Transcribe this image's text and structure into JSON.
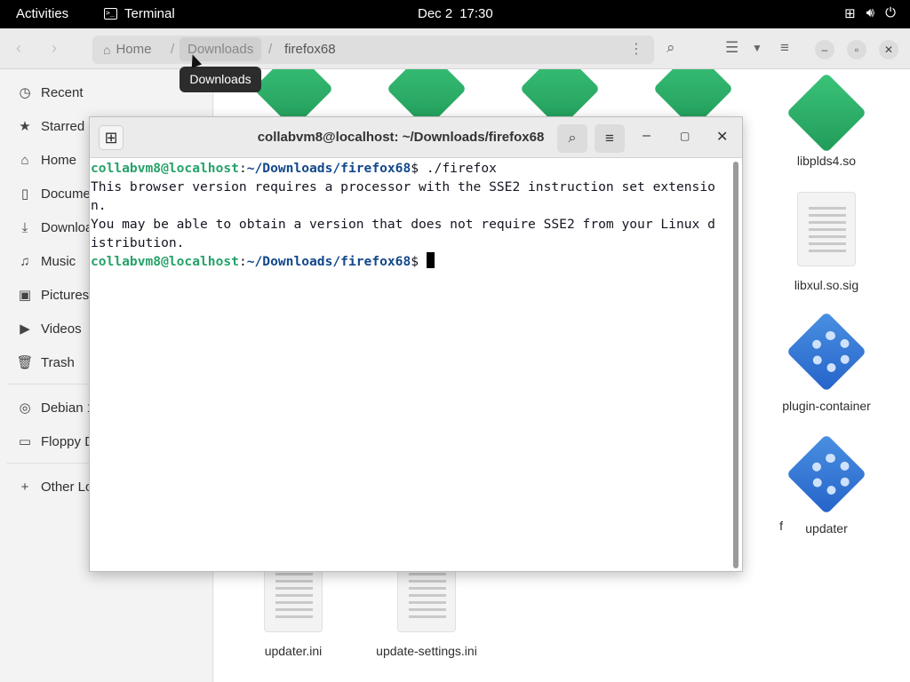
{
  "topbar": {
    "activities": "Activities",
    "app_name": "Terminal",
    "date": "Dec 2",
    "time": "17:30"
  },
  "file_manager": {
    "path": {
      "home": "Home",
      "downloads": "Downloads",
      "current": "firefox68"
    },
    "tooltip": "Downloads",
    "sidebar": {
      "items": [
        {
          "label": "Recent",
          "icon": "clock-icon"
        },
        {
          "label": "Starred",
          "icon": "star-icon"
        },
        {
          "label": "Home",
          "icon": "home-icon"
        },
        {
          "label": "Documents",
          "icon": "document-icon"
        },
        {
          "label": "Downloads",
          "icon": "download-icon"
        },
        {
          "label": "Music",
          "icon": "music-icon"
        },
        {
          "label": "Pictures",
          "icon": "pictures-icon"
        },
        {
          "label": "Videos",
          "icon": "video-icon"
        },
        {
          "label": "Trash",
          "icon": "trash-icon"
        }
      ],
      "devices": [
        {
          "label": "Debian 1",
          "icon": "disc-icon"
        },
        {
          "label": "Floppy D",
          "icon": "floppy-icon"
        }
      ],
      "other": {
        "label": "Other Lo",
        "icon": "plus-icon"
      }
    },
    "files": {
      "libplds4": "libplds4.so",
      "libxul_sig": "libxul.so.sig",
      "plugin_container": "plugin-container",
      "updater": "updater",
      "updater_ini": "updater.ini",
      "update_settings": "update-settings.ini",
      "partial_f": "f"
    }
  },
  "terminal": {
    "title": "collabvm8@localhost: ~/Downloads/firefox68",
    "prompt_user": "collabvm8@localhost",
    "prompt_sep": ":",
    "prompt_path": "~/Downloads/firefox68",
    "prompt_dollar": "$ ",
    "command": "./firefox",
    "output": [
      "This browser version requires a processor with the SSE2 instruction set extensio",
      "n.",
      "You may be able to obtain a version that does not require SSE2 from your Linux d",
      "istribution."
    ]
  }
}
